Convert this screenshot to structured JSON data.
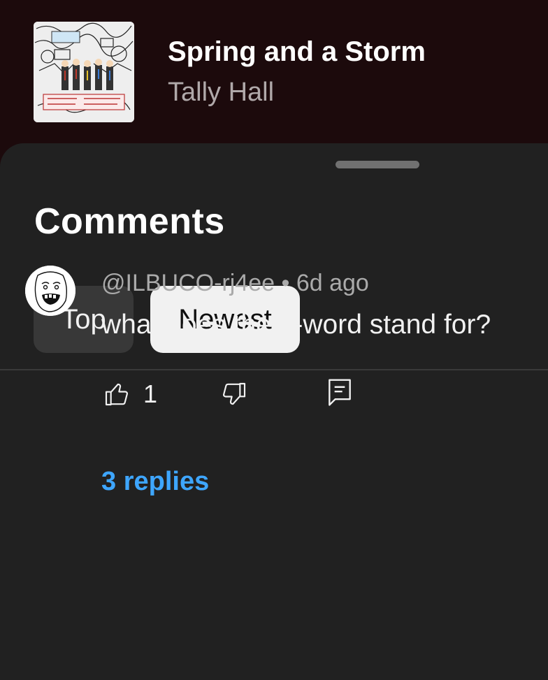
{
  "now_playing": {
    "title": "Spring and a Storm",
    "artist": "Tally Hall",
    "album_art_icon": "album-art-image"
  },
  "comments_sheet": {
    "title": "Comments",
    "sort_chips": [
      {
        "label": "Top",
        "selected": false
      },
      {
        "label": "Newest",
        "selected": true
      }
    ]
  },
  "comment": {
    "author": "@ILBUCO-rj4ee",
    "separator": " • ",
    "time": "6d ago",
    "text": "what does the n-word stand for?",
    "like_count": "1",
    "replies_label": "3 replies"
  },
  "colors": {
    "background": "#1c0a0c",
    "sheet": "#212121",
    "link_blue": "#3ea6ff",
    "chip_selected": "#f1f1f1",
    "chip_unselected": "#383838"
  }
}
